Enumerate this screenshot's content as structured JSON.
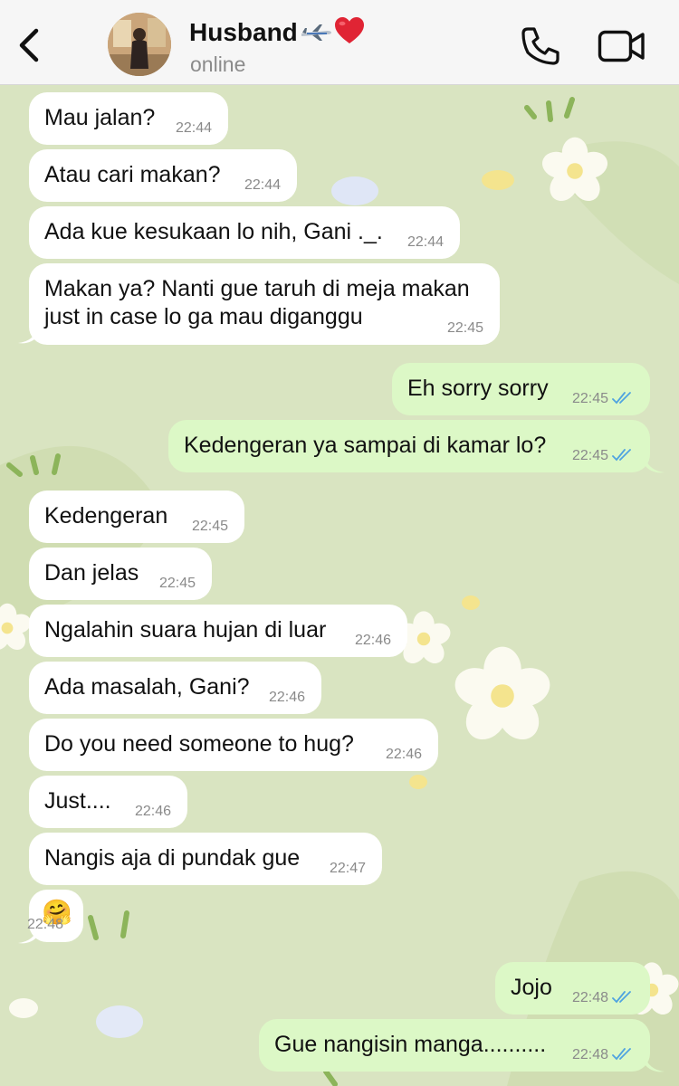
{
  "header": {
    "contact_name": "Husband",
    "status": "online",
    "icons": [
      "back-chevron-icon",
      "airplane-icon",
      "red-heart-icon",
      "phone-icon",
      "video-camera-icon"
    ]
  },
  "colors": {
    "incoming_bubble": "#ffffff",
    "outgoing_bubble": "#dcf8c6",
    "wallpaper": "#d9e4c1",
    "read_ticks": "#4fa3e0"
  },
  "messages": [
    {
      "dir": "in",
      "text": "Mau jalan?",
      "time": "22:44"
    },
    {
      "dir": "in",
      "text": "Atau cari makan?",
      "time": "22:44"
    },
    {
      "dir": "in",
      "text": "Ada kue kesukaan lo nih, Gani ._.",
      "time": "22:44"
    },
    {
      "dir": "in",
      "text": "Makan ya? Nanti gue taruh di meja makan",
      "text2": "just in case lo ga mau diganggu",
      "time": "22:45"
    },
    {
      "dir": "out",
      "text": "Eh sorry sorry",
      "time": "22:45",
      "status": "read"
    },
    {
      "dir": "out",
      "text": "Kedengeran ya sampai di kamar lo?",
      "time": "22:45",
      "status": "read"
    },
    {
      "dir": "in",
      "text": "Kedengeran",
      "time": "22:45"
    },
    {
      "dir": "in",
      "text": "Dan jelas",
      "time": "22:45"
    },
    {
      "dir": "in",
      "text": "Ngalahin suara hujan di luar",
      "time": "22:46"
    },
    {
      "dir": "in",
      "text": "Ada masalah, Gani?",
      "time": "22:46"
    },
    {
      "dir": "in",
      "text": "Do you need someone to hug?",
      "time": "22:46"
    },
    {
      "dir": "in",
      "text": "Just....",
      "time": "22:46"
    },
    {
      "dir": "in",
      "text": "Nangis aja di pundak gue",
      "time": "22:47"
    },
    {
      "dir": "in",
      "text": "🤗",
      "time": "22:48"
    },
    {
      "dir": "out",
      "text": "Jojo",
      "time": "22:48",
      "status": "read"
    },
    {
      "dir": "out",
      "text": "Gue nangisin manga..........",
      "time": "22:48",
      "status": "read"
    }
  ]
}
